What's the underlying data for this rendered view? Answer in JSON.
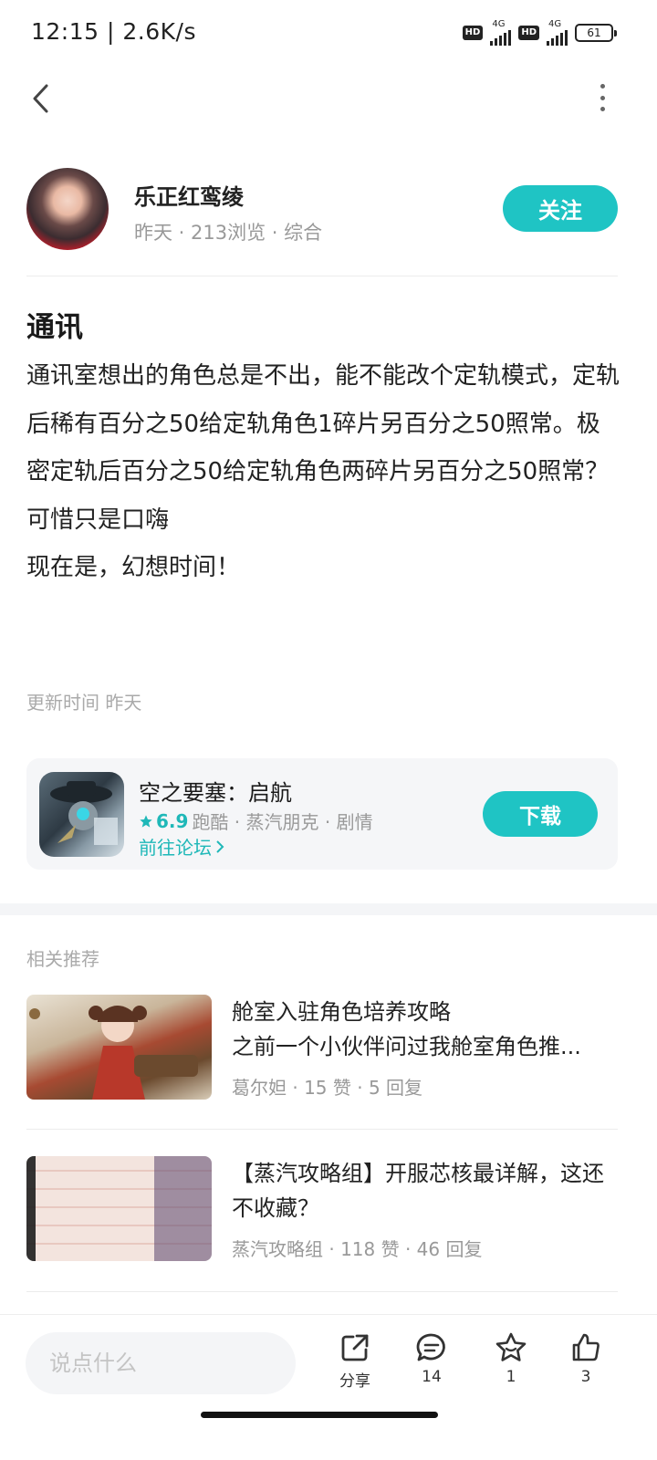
{
  "status_bar": {
    "time": "12:15 | 2.6K/s",
    "hd": "HD",
    "network": "4G",
    "battery": "61"
  },
  "author": {
    "name": "乐正红鸾绫",
    "meta": "昨天 · 213浏览 · 综合",
    "follow_label": "关注"
  },
  "post": {
    "title": "通讯",
    "paragraphs": [
      "通讯室想出的角色总是不出，能不能改个定轨模式，定轨后稀有百分之50给定轨角色1碎片另百分之50照常。极密定轨后百分之50给定轨角色两碎片另百分之50照常？",
      "可惜只是口嗨",
      "现在是，幻想时间！"
    ],
    "updated": "更新时间 昨天"
  },
  "game_card": {
    "name": "空之要塞：启航",
    "rating": "6.9",
    "tags": "跑酷 · 蒸汽朋克 · 剧情",
    "forum_link": "前往论坛",
    "download_label": "下载",
    "accent_color": "#1fc4c4"
  },
  "recommendations": {
    "heading": "相关推荐",
    "items": [
      {
        "title": "舱室入驻角色培养攻略",
        "subtitle": "之前一个小伙伴问过我舱室角色推...",
        "meta": "葛尔妲 · 15 赞 · 5 回复"
      },
      {
        "title": "【蒸汽攻略组】开服芯核最详解，这还不收藏？",
        "subtitle": "",
        "meta": "蒸汽攻略组 · 118 赞 · 46 回复"
      }
    ]
  },
  "bottom_bar": {
    "comment_placeholder": "说点什么",
    "share_label": "分享",
    "comment_count": "14",
    "favorite_count": "1",
    "like_count": "3"
  }
}
